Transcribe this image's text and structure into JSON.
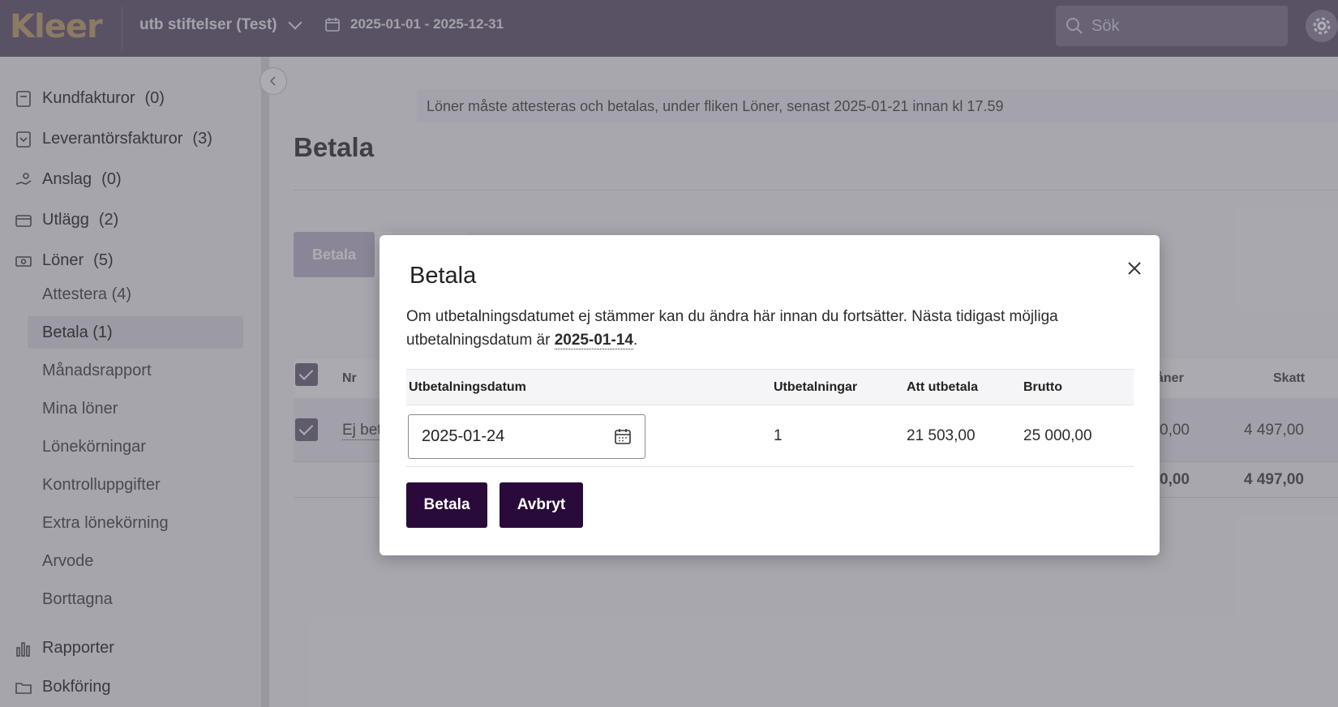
{
  "topbar": {
    "logo": "Kleer",
    "org_name": "utb stiftelser (Test)",
    "period": "2025-01-01 - 2025-12-31",
    "search_placeholder": "Sök"
  },
  "sidebar": {
    "main_items": [
      {
        "label": "Kundfakturor",
        "count": "(0)",
        "icon": "invoice-icon"
      },
      {
        "label": "Leverantörsfakturor",
        "count": "(3)",
        "icon": "inbox-icon"
      },
      {
        "label": "Anslag",
        "count": "(0)",
        "icon": "grant-hand-icon"
      },
      {
        "label": "Utlägg",
        "count": "(2)",
        "icon": "card-icon"
      },
      {
        "label": "Löner",
        "count": "(5)",
        "icon": "money-icon"
      }
    ],
    "sub_items": [
      "Attestera (4)",
      "Betala (1)",
      "Månadsrapport",
      "Mina löner",
      "Lönekörningar",
      "Kontrolluppgifter",
      "Extra lönekörning",
      "Arvode",
      "Borttagna"
    ],
    "bottom_items": [
      {
        "label": "Rapporter",
        "icon": "chart-bars-icon"
      },
      {
        "label": "Bokföring",
        "icon": "folder-icon"
      }
    ]
  },
  "main": {
    "notice": "Löner måste attesteras och betalas, under fliken Löner, senast 2025-01-21 innan kl 17.59",
    "title": "Betala",
    "pay_button": "Betala",
    "table": {
      "col_nr": "Nr",
      "col_loner_partial": "åner",
      "col_skatt": "Skatt",
      "row_status_partial": "Ej bet",
      "row_loner_partial": "0,00",
      "row_skatt": "4 497,00",
      "sum_loner_partial": "0,00",
      "sum_skatt": "4 497,00"
    }
  },
  "modal": {
    "title": "Betala",
    "text_before": "Om utbetalningsdatumet ej stämmer kan du ändra här innan du fortsätter. Nästa tidigast möjliga utbetalningsdatum är ",
    "earliest_date": "2025-01-14",
    "text_after": ".",
    "headers": {
      "date": "Utbetalningsdatum",
      "payments": "Utbetalningar",
      "to_pay": "Att utbetala",
      "gross": "Brutto"
    },
    "row": {
      "date": "2025-01-24",
      "payments": "1",
      "to_pay": "21 503,00",
      "gross": "25 000,00"
    },
    "pay_label": "Betala",
    "cancel_label": "Avbryt"
  },
  "colors": {
    "topbar": "#6e6479",
    "primary_button": "#2a0a3a",
    "logo": "#c8a97a"
  }
}
